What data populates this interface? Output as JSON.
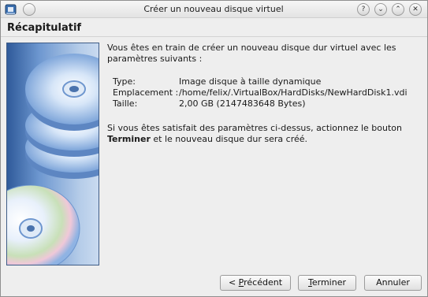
{
  "window": {
    "title": "Créer un nouveau disque virtuel",
    "buttons": {
      "help": "?",
      "minimize": "⌄",
      "maximize": "⌃",
      "close": "✕"
    }
  },
  "header": {
    "title": "Récapitulatif"
  },
  "content": {
    "intro": "Vous êtes en train de créer un nouveau disque dur virtuel avec les paramètres suivants :",
    "params": [
      {
        "key": "Type:",
        "value": "Image disque à taille dynamique"
      },
      {
        "key": "Emplacement :",
        "value": "/home/felix/.VirtualBox/HardDisks/NewHardDisk1.vdi"
      },
      {
        "key": "Taille:",
        "value": "2,00 GB (2147483648 Bytes)"
      }
    ],
    "summary_pre": "Si vous êtes satisfait des paramètres ci-dessus, actionnez le bouton ",
    "summary_bold": "Terminer",
    "summary_post": " et le nouveau disque dur sera créé."
  },
  "footer": {
    "back_prefix": "< ",
    "back_mnemonic": "P",
    "back_rest": "récédent",
    "finish_mnemonic": "T",
    "finish_rest": "erminer",
    "cancel": "Annuler"
  },
  "colors": {
    "accent": "#4f7fc4",
    "panel_dark": "#2f5a9a",
    "panel_light": "#c9daf0"
  },
  "icons": [
    "virtualbox-app-icon",
    "disc-stack-icon",
    "single-disc-icon"
  ]
}
